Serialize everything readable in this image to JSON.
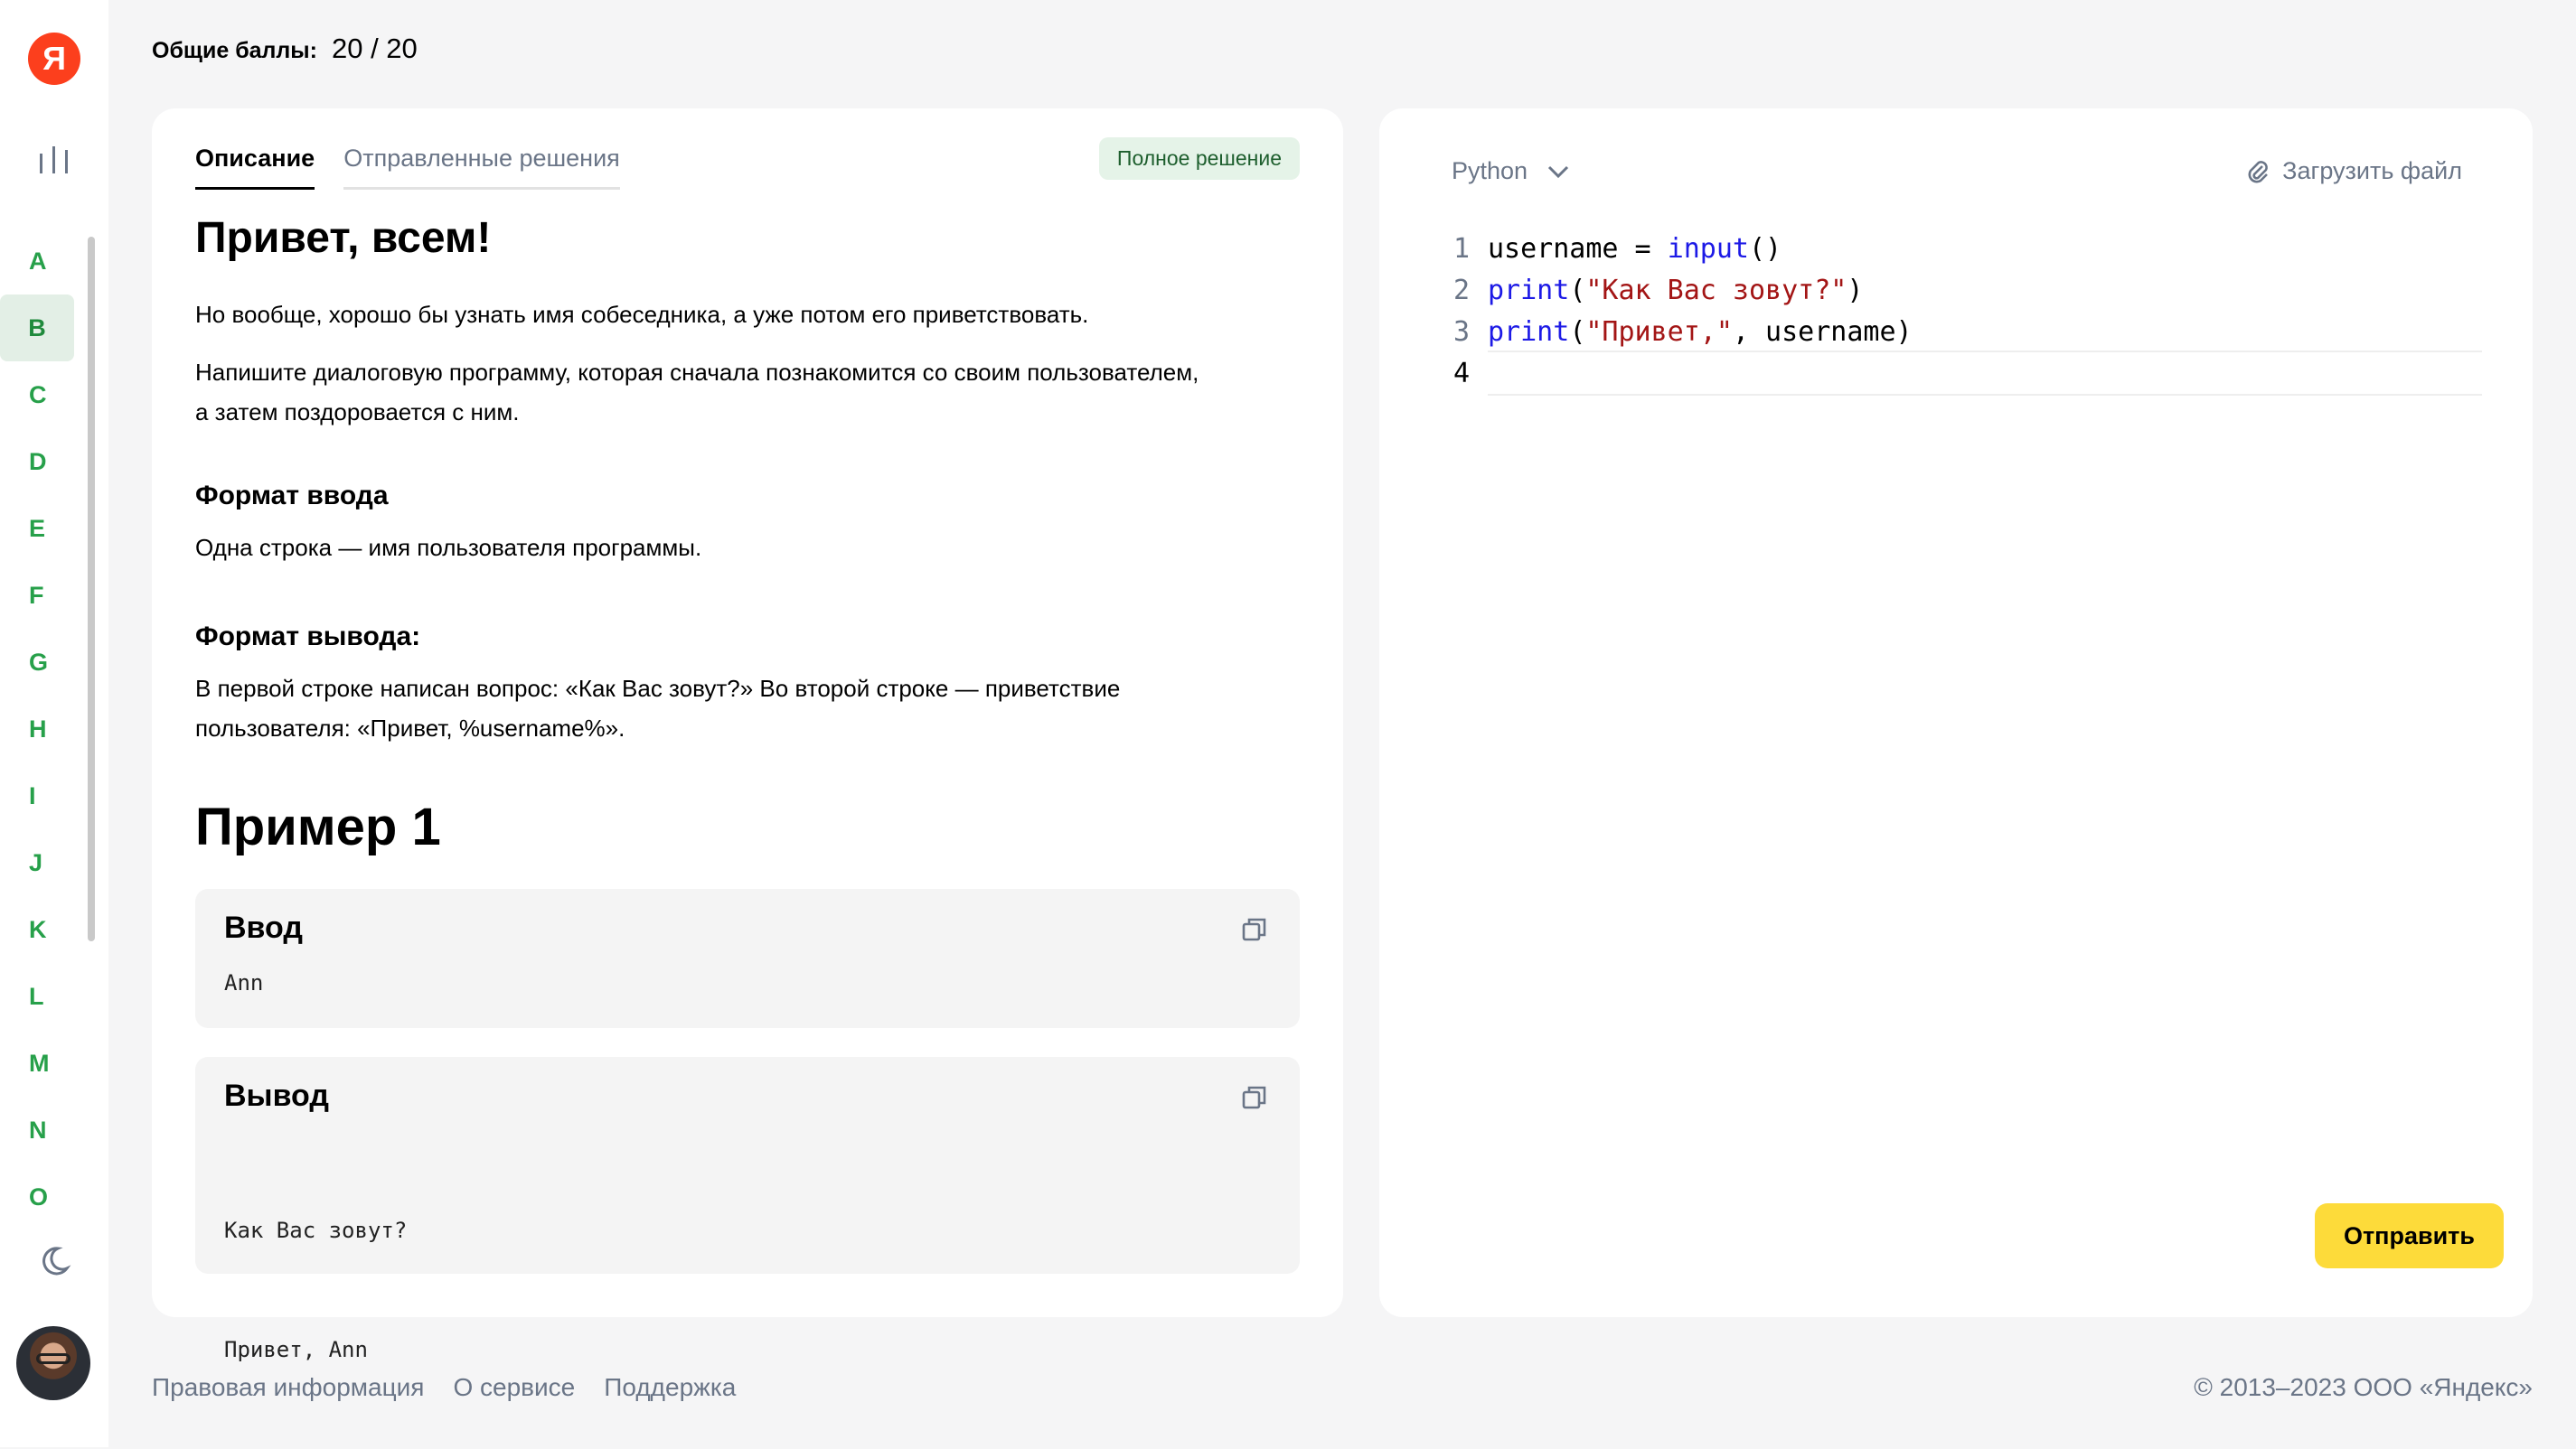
{
  "sidebar": {
    "logo_letter": "Я",
    "problem_letters": [
      "A",
      "B",
      "C",
      "D",
      "E",
      "F",
      "G",
      "H",
      "I",
      "J",
      "K",
      "L",
      "M",
      "N",
      "O"
    ],
    "active_letter": "B"
  },
  "score": {
    "label": "Общие баллы:",
    "value": "20 / 20"
  },
  "task": {
    "tabs": [
      "Описание",
      "Отправленные решения"
    ],
    "active_tab": "Описание",
    "badge": "Полное решение",
    "title": "Привет, всем!",
    "intro": "Но вообще, хорошо бы узнать имя собеседника, а уже потом его приветствовать.",
    "body_line1": "Напишите диалоговую программу, которая сначала познакомится со своим пользователем,",
    "body_line2": "а затем поздоровается с ним.",
    "input_format_heading": "Формат ввода",
    "input_format_text": "Одна строка — имя пользователя программы.",
    "output_format_heading": "Формат вывода:",
    "output_format_line1": "В первой строке написан вопрос: «Как Вас зовут?» Во второй строке — приветствие",
    "output_format_line2": "пользователя: «Привет, %username%».",
    "example_heading": "Пример 1",
    "example_input_title": "Ввод",
    "example_input": "Ann",
    "example_output_title": "Вывод",
    "example_output_line1": "Как Вас зовут?",
    "example_output_line2": "Привет, Ann"
  },
  "editor": {
    "language": "Python",
    "upload_label": "Загрузить файл",
    "line_numbers": [
      "1",
      "2",
      "3",
      "4"
    ],
    "submit_label": "Отправить"
  },
  "footer": {
    "links": [
      "Правовая информация",
      "О сервисе",
      "Поддержка"
    ],
    "copyright": "© 2013–2023 ООО «Яндекс»"
  },
  "colors": {
    "accent_green": "#27a04a",
    "submit_yellow": "#fddb3a",
    "logo_red": "#fc3f1d"
  }
}
